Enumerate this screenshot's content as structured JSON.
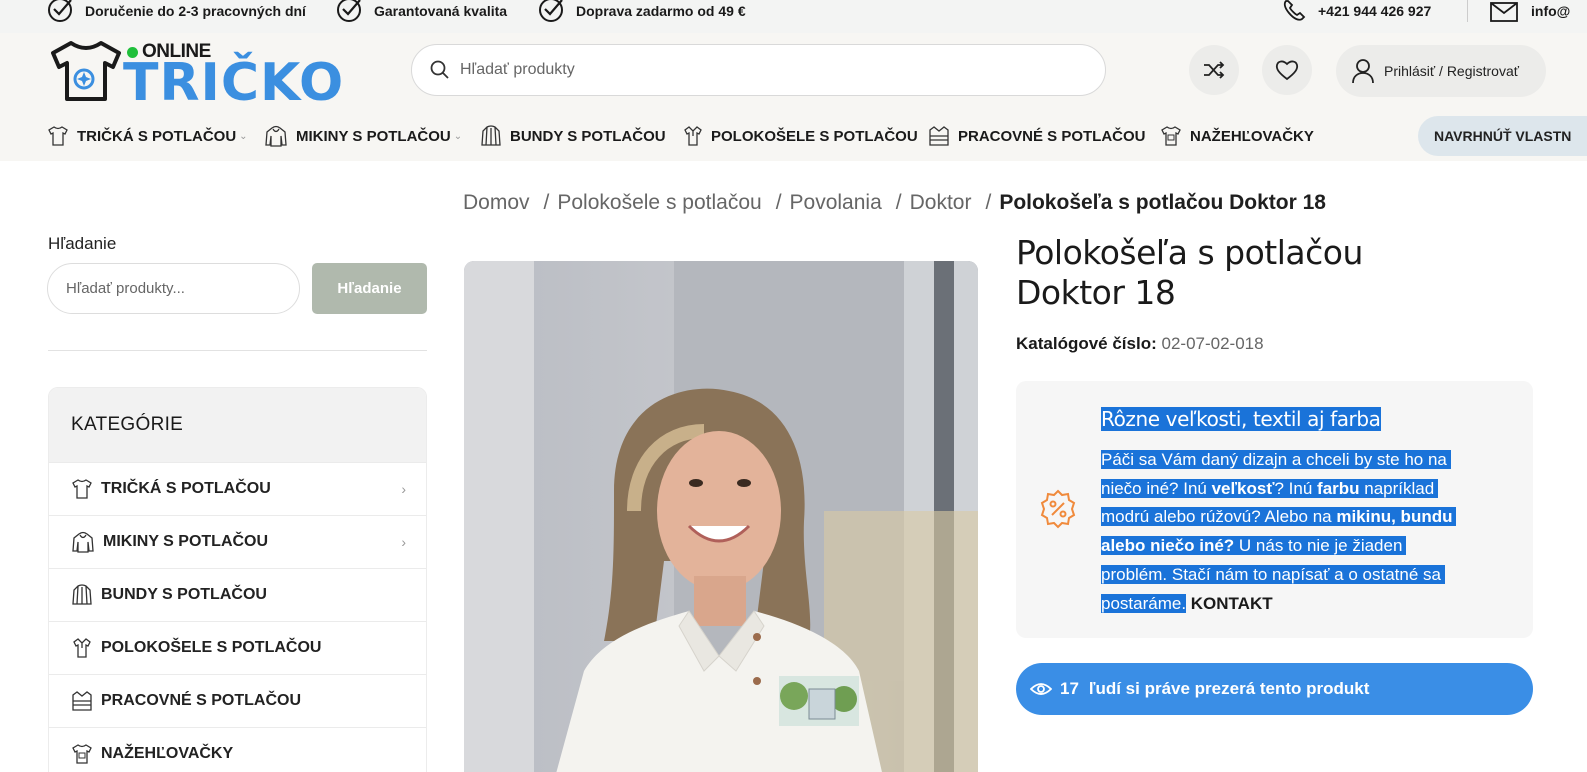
{
  "topbar": {
    "items": [
      {
        "label": "Doručenie do 2-3 pracovných dní",
        "icon": "check-circle-icon"
      },
      {
        "label": "Garantovaná kvalita",
        "icon": "check-circle-icon"
      },
      {
        "label": "Doprava zadarmo od 49 €",
        "icon": "check-circle-icon"
      }
    ],
    "phone": "+421 944 426 927",
    "email": "info@"
  },
  "logo": {
    "small": "ONLINE",
    "big": "TRIČKO"
  },
  "search": {
    "placeholder": "Hľadať produkty"
  },
  "header": {
    "login_label": "Prihlásiť / Registrovať"
  },
  "nav": {
    "items": [
      {
        "label": "TRIČKÁ S POTLAČOU",
        "has_dropdown": true
      },
      {
        "label": "MIKINY S POTLAČOU",
        "has_dropdown": true
      },
      {
        "label": "BUNDY S POTLAČOU",
        "has_dropdown": false
      },
      {
        "label": "POLOKOŠELE S POTLAČOU",
        "has_dropdown": false
      },
      {
        "label": "PRACOVNÉ S POTLAČOU",
        "has_dropdown": false
      },
      {
        "label": "NAŽEHĽOVAČKY",
        "has_dropdown": false
      }
    ],
    "design_button": "NAVRHNÚŤ VLASTN"
  },
  "breadcrumb": {
    "items": [
      "Domov",
      "Polokošele s potlačou",
      "Povolania",
      "Doktor"
    ],
    "current": "Polokošeľa s potlačou Doktor 18"
  },
  "sidebar": {
    "search_label": "Hľadanie",
    "search_placeholder": "Hľadať produkty...",
    "search_button": "Hľadanie",
    "categories_title": "KATEGÓRIE",
    "categories": [
      {
        "label": "TRIČKÁ S POTLAČOU",
        "has_children": true
      },
      {
        "label": "MIKINY S POTLAČOU",
        "has_children": true
      },
      {
        "label": "BUNDY S POTLAČOU",
        "has_children": false
      },
      {
        "label": "POLOKOŠELE S POTLAČOU",
        "has_children": false
      },
      {
        "label": "PRACOVNÉ S POTLAČOU",
        "has_children": false
      },
      {
        "label": "NAŽEHĽOVAČKY",
        "has_children": false
      }
    ]
  },
  "product": {
    "title_line1": "Polokošeľa s potlačou",
    "title_line2": "Doktor 18",
    "sku_label": "Katalógové číslo:",
    "sku_value": "02-07-02-018",
    "promo": {
      "title": "Rôzne veľkosti, textil aj farba",
      "p1": "Páči sa Vám daný dizajn a chceli by ste ho na",
      "p2a": "niečo iné? Inú ",
      "p2b": "veľkosť",
      "p2c": "? Inú ",
      "p2d": "farbu",
      "p2e": " napríklad",
      "p3a": "modrú alebo rúžovú? Alebo na ",
      "p3b": "mikinu, bundu",
      "p4a": "alebo niečo iné?",
      "p4b": " U nás to nie je žiaden",
      "p5": "problém. Stačí nám to napísať a o ostatné sa",
      "p6": "postaráme.",
      "contact": "KONTAKT"
    },
    "viewers_count": "17",
    "viewers_text": "ľudí si práve prezerá tento produkt"
  },
  "colors": {
    "brand_blue": "#3b8fe0",
    "viewers_blue": "#3a8ee6",
    "selection_blue": "#1a73d9",
    "search_button": "#b0b9ad",
    "promo_icon": "#f08a3c"
  }
}
